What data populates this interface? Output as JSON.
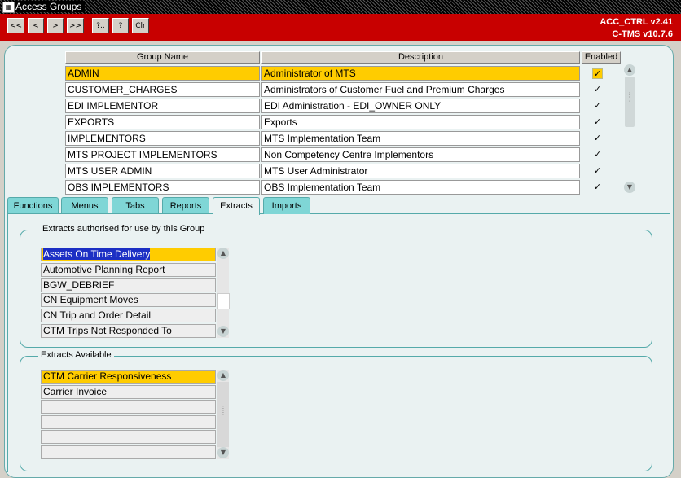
{
  "window": {
    "title": "Access Groups"
  },
  "toolbar": {
    "buttons": [
      "<<",
      "<",
      ">",
      ">>",
      "?..",
      "?",
      "Clr"
    ],
    "version_line1": "ACC_CTRL v2.41",
    "version_line2": "C-TMS v10.7.6"
  },
  "groups_table": {
    "headers": {
      "group_name": "Group Name",
      "description": "Description",
      "enabled": "Enabled"
    },
    "rows": [
      {
        "name": "ADMIN",
        "description": "Administrator of MTS",
        "enabled": true
      },
      {
        "name": "CUSTOMER_CHARGES",
        "description": "Administrators of Customer Fuel and Premium Charges",
        "enabled": true
      },
      {
        "name": "EDI IMPLEMENTOR",
        "description": "EDI Administration - EDI_OWNER ONLY",
        "enabled": true
      },
      {
        "name": "EXPORTS",
        "description": "Exports",
        "enabled": true
      },
      {
        "name": "IMPLEMENTORS",
        "description": "MTS Implementation Team",
        "enabled": true
      },
      {
        "name": "MTS PROJECT IMPLEMENTORS",
        "description": "Non Competency Centre Implementors",
        "enabled": true
      },
      {
        "name": "MTS USER ADMIN",
        "description": "MTS User Administrator",
        "enabled": true
      },
      {
        "name": "OBS IMPLEMENTORS",
        "description": "OBS Implementation Team",
        "enabled": true
      }
    ]
  },
  "tabs": [
    "Functions",
    "Menus",
    "Tabs",
    "Reports",
    "Extracts",
    "Imports"
  ],
  "active_tab": "Extracts",
  "authorised": {
    "label": "Extracts authorised for use by this Group",
    "items": [
      "Assets On Time Delivery",
      "Automotive Planning Report",
      "BGW_DEBRIEF",
      "CN Equipment Moves",
      "CN Trip and Order Detail",
      "CTM Trips Not Responded To"
    ]
  },
  "available": {
    "label": "Extracts Available",
    "items": [
      "CTM Carrier Responsiveness",
      "Carrier Invoice",
      "",
      "",
      "",
      ""
    ]
  },
  "colors": {
    "selection": "#ffcc00",
    "toolbar": "#c80000",
    "tab": "#7fd6d6",
    "text_highlight": "#1c2fc4"
  }
}
